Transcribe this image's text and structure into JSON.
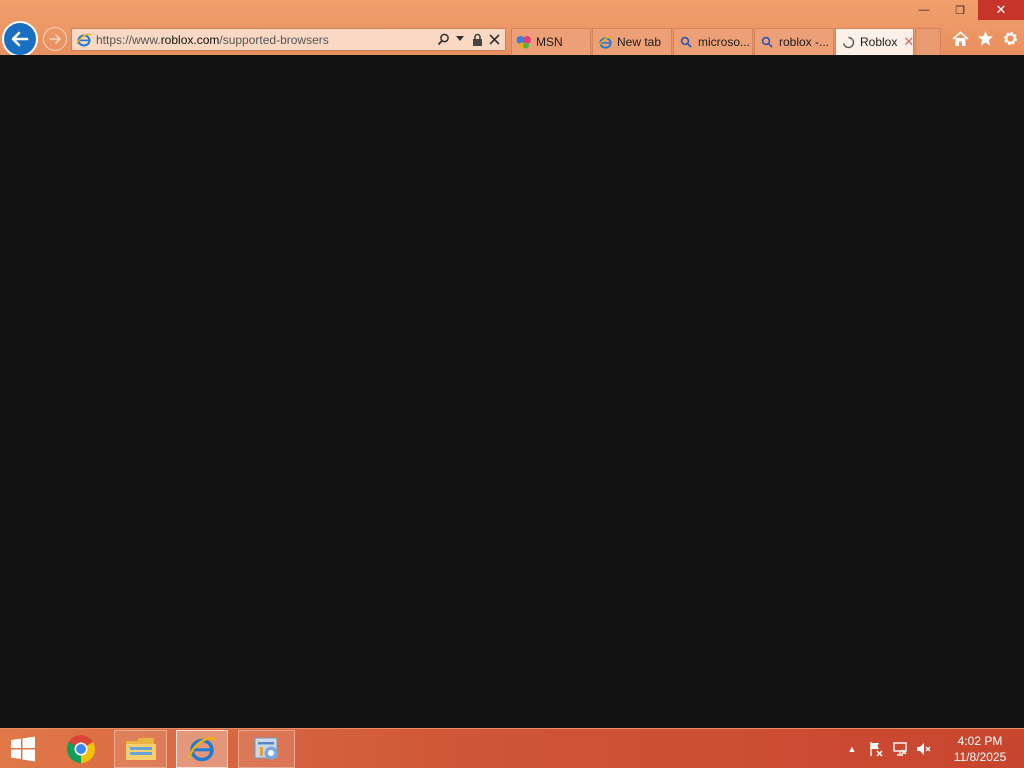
{
  "window_controls": {
    "minimize": "—",
    "restore": "❐",
    "close": "✕"
  },
  "address_bar": {
    "scheme": "https://www.",
    "domain": "roblox.com",
    "path": "/supported-browsers"
  },
  "tabs": [
    {
      "label": "MSN",
      "icon": "msn-butterfly-icon"
    },
    {
      "label": "New tab",
      "icon": "ie-icon"
    },
    {
      "label": "microso...",
      "icon": "search-icon"
    },
    {
      "label": "roblox -...",
      "icon": "search-icon"
    },
    {
      "label": "Roblox",
      "icon": "loading-spinner-icon",
      "active": true,
      "close": "✕"
    }
  ],
  "taskbar": {
    "apps": [
      "chrome-icon",
      "file-explorer-icon",
      "internet-explorer-icon",
      "control-panel-icon"
    ]
  },
  "clock": {
    "time": "4:02 PM",
    "date": "11/8/2025"
  },
  "colors": {
    "chrome": "#e98f5f",
    "taskbar": "#c8452e",
    "content": "#121212",
    "back_button": "#1a6fc0"
  }
}
